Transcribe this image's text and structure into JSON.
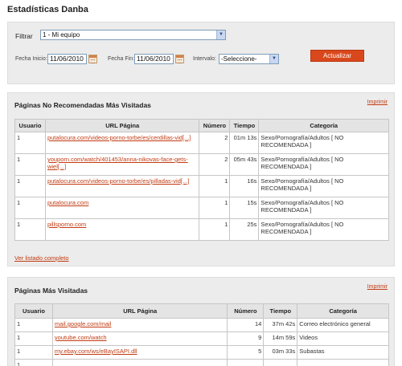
{
  "title": "Estadísticas Danba",
  "filter": {
    "label": "Filtrar",
    "selected": "1 - Mi equipo",
    "start_label": "Fecha Inicio:",
    "start_value": "11/06/2010",
    "end_label": "Fecha Fin:",
    "end_value": "11/06/2010",
    "interval_label": "Intervalo:",
    "interval_value": "-Seleccione-",
    "update_button": "Actualizar"
  },
  "not_recommended": {
    "title": "Páginas No Recomendadas Más Visitadas",
    "print": "Imprimir",
    "columns": [
      "Usuario",
      "URL Página",
      "Número",
      "Tiempo",
      "Categoría"
    ],
    "rows": [
      {
        "user": "1",
        "url": "putalocura.com/videos-porno-torbe/es/cerdillas-vid[...]",
        "count": "2",
        "time": "01m 13s",
        "category": "Sexo/Pornografía/Adultos [ NO RECOMENDADA ]"
      },
      {
        "user": "1",
        "url": "youporn.com/watch/401453/anna-nikovas-face-gets-wiel[...]",
        "count": "2",
        "time": "05m 43s",
        "category": "Sexo/Pornografía/Adultos [ NO RECOMENDADA ]"
      },
      {
        "user": "1",
        "url": "putalocura.com/videos-porno-torbe/es/pilladas-vid[...]",
        "count": "1",
        "time": "16s",
        "category": "Sexo/Pornografía/Adultos [ NO RECOMENDADA ]"
      },
      {
        "user": "1",
        "url": "putalocura.com",
        "count": "1",
        "time": "15s",
        "category": "Sexo/Pornografía/Adultos [ NO RECOMENDADA ]"
      },
      {
        "user": "1",
        "url": "pillsporno.com",
        "count": "1",
        "time": "25s",
        "category": "Sexo/Pornografía/Adultos [ NO RECOMENDADA ]"
      }
    ],
    "full_list": "Ver listado completo"
  },
  "most_visited": {
    "title": "Páginas Más Visitadas",
    "print": "Imprimir",
    "columns": [
      "Usuario",
      "URL Página",
      "Número",
      "Tiempo",
      "Categoría"
    ],
    "rows": [
      {
        "user": "1",
        "url": "mail.google.com/mail",
        "count": "14",
        "time": "37m 42s",
        "category": "Correo electrónico general"
      },
      {
        "user": "1",
        "url": "youtube.com/watch",
        "count": "9",
        "time": "14m 59s",
        "category": "Videos"
      },
      {
        "user": "1",
        "url": "my.ebay.com/ws/eBayISAPI.dll",
        "count": "5",
        "time": "03m 33s",
        "category": "Subastas"
      },
      {
        "user": "1",
        "url": "",
        "count": "",
        "time": "",
        "category": ""
      }
    ]
  },
  "icons": {
    "calendar": "calendar-icon",
    "dropdown": "chevron-down-icon"
  },
  "colors": {
    "accent": "#d9481c",
    "link": "#c23b12",
    "panel_bg": "#ececec"
  }
}
